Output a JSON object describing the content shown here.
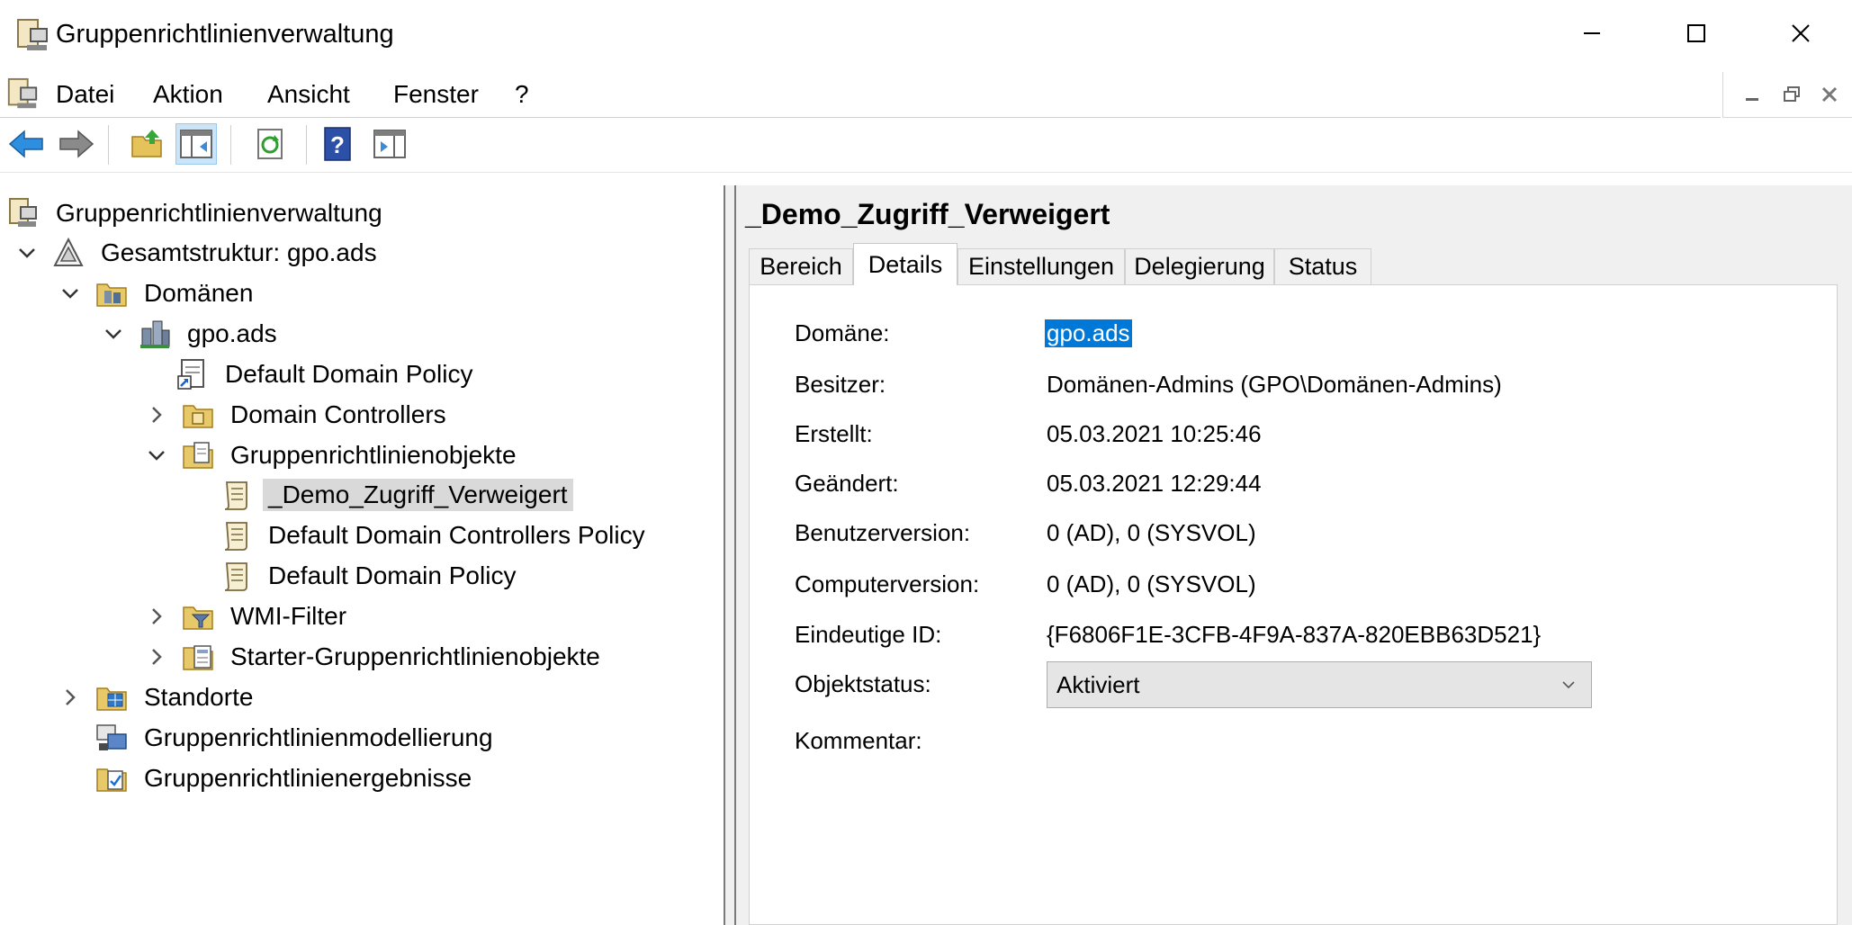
{
  "window": {
    "title": "Gruppenrichtlinienverwaltung"
  },
  "menu": [
    "Datei",
    "Aktion",
    "Ansicht",
    "Fenster",
    "?"
  ],
  "tree": {
    "root": "Gruppenrichtlinienverwaltung",
    "forest": "Gesamtstruktur: gpo.ads",
    "domains": "Domänen",
    "domain": "gpo.ads",
    "default_domain_policy_link": "Default Domain Policy",
    "domain_controllers": "Domain Controllers",
    "gpo_container": "Gruppenrichtlinienobjekte",
    "gpo_demo": "_Demo_Zugriff_Verweigert",
    "gpo_dc_policy": "Default Domain Controllers Policy",
    "gpo_domain_policy": "Default Domain Policy",
    "wmi_filter": "WMI-Filter",
    "starter_gpos": "Starter-Gruppenrichtlinienobjekte",
    "sites": "Standorte",
    "modeling": "Gruppenrichtlinienmodellierung",
    "results": "Gruppenrichtlinienergebnisse"
  },
  "detail": {
    "title": "_Demo_Zugriff_Verweigert",
    "tabs": [
      "Bereich",
      "Details",
      "Einstellungen",
      "Delegierung",
      "Status"
    ],
    "active_tab": "Details",
    "props": {
      "domain_label": "Domäne:",
      "domain_value": "gpo.ads",
      "owner_label": "Besitzer:",
      "owner_value": "Domänen-Admins (GPO\\Domänen-Admins)",
      "created_label": "Erstellt:",
      "created_value": "05.03.2021 10:25:46",
      "modified_label": "Geändert:",
      "modified_value": "05.03.2021 12:29:44",
      "user_version_label": "Benutzerversion:",
      "user_version_value": "0 (AD), 0 (SYSVOL)",
      "computer_version_label": "Computerversion:",
      "computer_version_value": "0 (AD), 0 (SYSVOL)",
      "unique_id_label": "Eindeutige ID:",
      "unique_id_value": "{F6806F1E-3CFB-4F9A-837A-820EBB63D521}",
      "status_label": "Objektstatus:",
      "status_value": "Aktiviert",
      "comment_label": "Kommentar:"
    }
  },
  "colors": {
    "selection": "#0078d7",
    "tree_selected": "#d9d9d9",
    "pane_bg": "#f0f0f0"
  }
}
